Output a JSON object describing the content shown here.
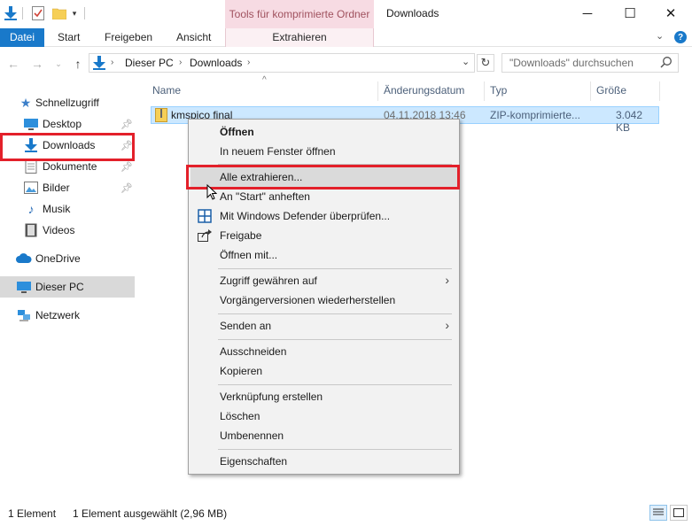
{
  "window": {
    "context_tab_title": "Tools für komprimierte Ordner",
    "title": "Downloads",
    "minimize": "─",
    "maximize": "☐",
    "close": "✕"
  },
  "ribbon": {
    "tabs": [
      "Datei",
      "Start",
      "Freigeben",
      "Ansicht"
    ],
    "context_tab": "Extrahieren"
  },
  "address": {
    "path": [
      "Dieser PC",
      "Downloads"
    ],
    "search_placeholder": "\"Downloads\" durchsuchen"
  },
  "sidebar": {
    "items": [
      {
        "label": "Schnellzugriff",
        "icon": "star-icon"
      },
      {
        "label": "Desktop",
        "icon": "desktop-icon",
        "pinned": true
      },
      {
        "label": "Downloads",
        "icon": "download-arrow-icon",
        "pinned": true
      },
      {
        "label": "Dokumente",
        "icon": "documents-icon",
        "pinned": true
      },
      {
        "label": "Bilder",
        "icon": "pictures-icon",
        "pinned": true
      },
      {
        "label": "Musik",
        "icon": "music-icon"
      },
      {
        "label": "Videos",
        "icon": "video-icon"
      },
      {
        "label": "OneDrive",
        "icon": "cloud-icon"
      },
      {
        "label": "Dieser PC",
        "icon": "computer-icon",
        "selected": true
      },
      {
        "label": "Netzwerk",
        "icon": "network-icon"
      }
    ]
  },
  "filelist": {
    "columns": [
      "Name",
      "Änderungsdatum",
      "Typ",
      "Größe"
    ],
    "rows": [
      {
        "name": "kmspico final",
        "date": "04.11.2018 13:46",
        "type": "ZIP-komprimierte...",
        "size": "3.042 KB"
      }
    ]
  },
  "context_menu": {
    "items": [
      "Öffnen",
      "In neuem Fenster öffnen",
      "Alle extrahieren...",
      "An \"Start\" anheften",
      "Mit Windows Defender überprüfen...",
      "Freigabe",
      "Öffnen mit...",
      "Zugriff gewähren auf",
      "Vorgängerversionen wiederherstellen",
      "Senden an",
      "Ausschneiden",
      "Kopieren",
      "Verknüpfung erstellen",
      "Löschen",
      "Umbenennen",
      "Eigenschaften"
    ]
  },
  "status": {
    "count": "1 Element",
    "selection": "1 Element ausgewählt (2,96 MB)"
  },
  "colors": {
    "accent": "#1979ca",
    "highlight_box": "#e3202a",
    "selection": "#cce8ff"
  }
}
